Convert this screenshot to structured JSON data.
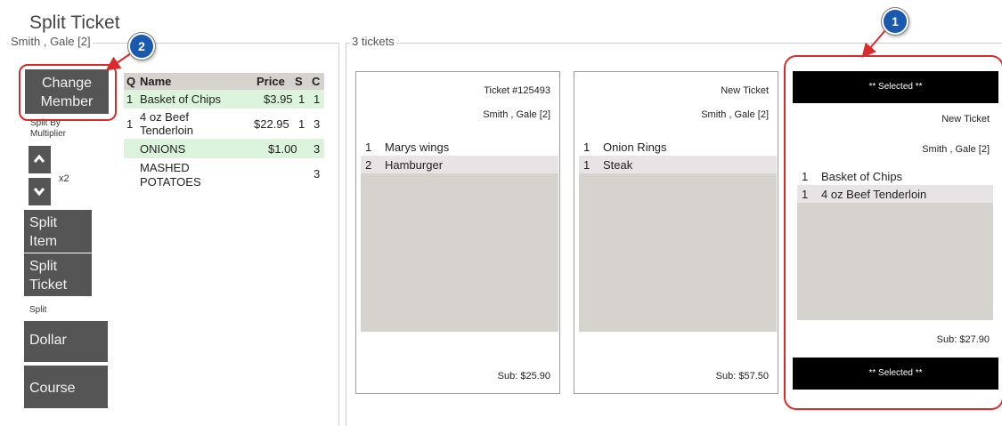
{
  "title": "Split Ticket",
  "left_group": {
    "title": "Smith , Gale [2]",
    "change_member_line1": "Change",
    "change_member_line2": "Member",
    "split_by_line1": "Split By",
    "split_by_line2": "Multiplier",
    "multiplier": "x2",
    "split_item_line1": "Split",
    "split_item_line2": "Item",
    "split_ticket_line1": "Split",
    "split_ticket_line2": "Ticket",
    "split_label": "Split",
    "dollar": "Dollar",
    "course": "Course"
  },
  "items_table": {
    "headers": {
      "q": "Q",
      "name": "Name",
      "price": "Price",
      "s": "S",
      "c": "C"
    },
    "rows": [
      {
        "q": "1",
        "name_line1": "Basket of Chips",
        "name_line2": "",
        "price": "$3.95",
        "s": "1",
        "c": "1",
        "highlight": true
      },
      {
        "q": "1",
        "name_line1": "4 oz Beef",
        "name_line2": "Tenderloin",
        "price": "$22.95",
        "s": "1",
        "c": "3",
        "highlight": false
      },
      {
        "q": "",
        "name_line1": "ONIONS",
        "name_line2": "",
        "price": "$1.00",
        "s": "",
        "c": "3",
        "highlight": true
      },
      {
        "q": "",
        "name_line1": "MASHED",
        "name_line2": "POTATOES",
        "price": "",
        "s": "",
        "c": "3",
        "highlight": false
      }
    ]
  },
  "tickets_group": {
    "title": "3 tickets",
    "tickets": [
      {
        "number": "Ticket #125493",
        "member": "Smith , Gale [2]",
        "lines": [
          {
            "q": "1",
            "item": "Marys wings"
          },
          {
            "q": "2",
            "item": "Hamburger"
          }
        ],
        "subtotal": "Sub: $25.90"
      },
      {
        "number": "New Ticket",
        "member": "Smith , Gale [2]",
        "lines": [
          {
            "q": "1",
            "item": "Onion Rings"
          },
          {
            "q": "1",
            "item": "Steak"
          }
        ],
        "subtotal": "Sub: $57.50"
      },
      {
        "selected_label": "** Selected **",
        "number": "New Ticket",
        "member": "Smith , Gale [2]",
        "lines": [
          {
            "q": "1",
            "item": "Basket of Chips"
          },
          {
            "q": "1",
            "item": "4 oz Beef Tenderloin"
          }
        ],
        "subtotal": "Sub: $27.90"
      }
    ]
  },
  "callouts": {
    "badge1": "1",
    "badge2": "2"
  },
  "colors": {
    "button_bg": "#555555",
    "highlight_row": "#dcf3dc",
    "callout_red": "#d92b2b",
    "badge_blue": "#1a59b0",
    "selected_bar": "#000000"
  },
  "icons": [
    "chevron-up-icon",
    "chevron-down-icon",
    "arrow-icon"
  ]
}
